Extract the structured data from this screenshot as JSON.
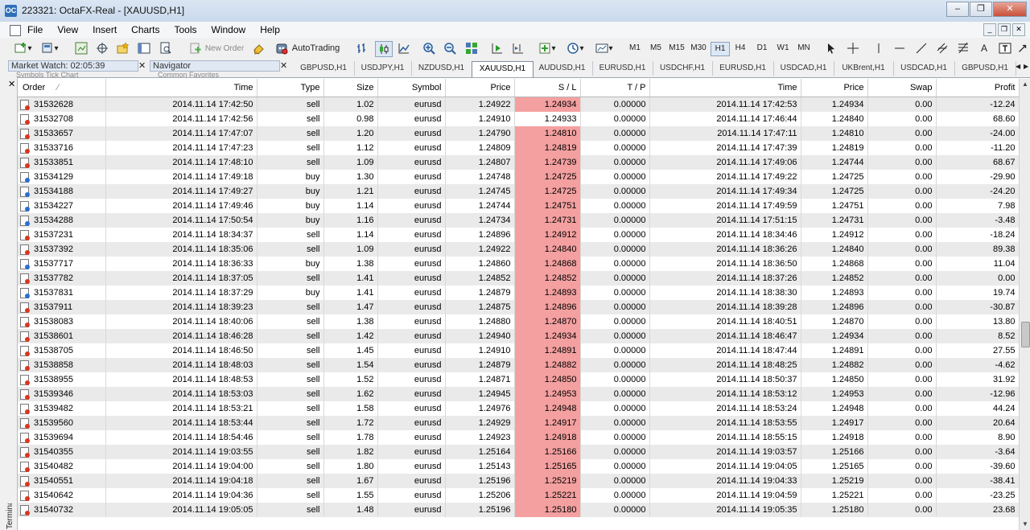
{
  "window": {
    "title": "223321: OctaFX-Real - [XAUUSD,H1]",
    "app_icon": "OC"
  },
  "menu": [
    "File",
    "View",
    "Insert",
    "Charts",
    "Tools",
    "Window",
    "Help"
  ],
  "toolbar": {
    "new_order": "New Order",
    "autotrading": "AutoTrading",
    "timeframes": [
      "M1",
      "M5",
      "M15",
      "M30",
      "H1",
      "H4",
      "D1",
      "W1",
      "MN"
    ],
    "active_timeframe": "H1"
  },
  "panels": {
    "market_watch": "Market Watch: 02:05:39",
    "market_watch_tabs": "Symbols    Tick Chart",
    "navigator": "Navigator",
    "navigator_tabs": "Common    Favorites"
  },
  "chart_tabs": [
    "GBPUSD,H1",
    "USDJPY,H1",
    "NZDUSD,H1",
    "XAUUSD,H1",
    "AUDUSD,H1",
    "EURUSD,H1",
    "USDCHF,H1",
    "EURUSD,H1",
    "USDCAD,H1",
    "UKBrent,H1",
    "USDCAD,H1",
    "GBPUSD,H1"
  ],
  "active_chart_tab": "XAUUSD,H1",
  "table": {
    "columns": [
      "Order",
      "Time",
      "Type",
      "Size",
      "Symbol",
      "Price",
      "S / L",
      "T / P",
      "Time",
      "Price",
      "Swap",
      "Profit"
    ],
    "rows": [
      [
        "31532628",
        "2014.11.14 17:42:50",
        "sell",
        "1.02",
        "eurusd",
        "1.24922",
        "1.24934",
        "0.00000",
        "2014.11.14 17:42:53",
        "1.24934",
        "0.00",
        "-12.24"
      ],
      [
        "31532708",
        "2014.11.14 17:42:56",
        "sell",
        "0.98",
        "eurusd",
        "1.24910",
        "1.24933",
        "0.00000",
        "2014.11.14 17:46:44",
        "1.24840",
        "0.00",
        "68.60"
      ],
      [
        "31533657",
        "2014.11.14 17:47:07",
        "sell",
        "1.20",
        "eurusd",
        "1.24790",
        "1.24810",
        "0.00000",
        "2014.11.14 17:47:11",
        "1.24810",
        "0.00",
        "-24.00"
      ],
      [
        "31533716",
        "2014.11.14 17:47:23",
        "sell",
        "1.12",
        "eurusd",
        "1.24809",
        "1.24819",
        "0.00000",
        "2014.11.14 17:47:39",
        "1.24819",
        "0.00",
        "-11.20"
      ],
      [
        "31533851",
        "2014.11.14 17:48:10",
        "sell",
        "1.09",
        "eurusd",
        "1.24807",
        "1.24739",
        "0.00000",
        "2014.11.14 17:49:06",
        "1.24744",
        "0.00",
        "68.67"
      ],
      [
        "31534129",
        "2014.11.14 17:49:18",
        "buy",
        "1.30",
        "eurusd",
        "1.24748",
        "1.24725",
        "0.00000",
        "2014.11.14 17:49:22",
        "1.24725",
        "0.00",
        "-29.90"
      ],
      [
        "31534188",
        "2014.11.14 17:49:27",
        "buy",
        "1.21",
        "eurusd",
        "1.24745",
        "1.24725",
        "0.00000",
        "2014.11.14 17:49:34",
        "1.24725",
        "0.00",
        "-24.20"
      ],
      [
        "31534227",
        "2014.11.14 17:49:46",
        "buy",
        "1.14",
        "eurusd",
        "1.24744",
        "1.24751",
        "0.00000",
        "2014.11.14 17:49:59",
        "1.24751",
        "0.00",
        "7.98"
      ],
      [
        "31534288",
        "2014.11.14 17:50:54",
        "buy",
        "1.16",
        "eurusd",
        "1.24734",
        "1.24731",
        "0.00000",
        "2014.11.14 17:51:15",
        "1.24731",
        "0.00",
        "-3.48"
      ],
      [
        "31537231",
        "2014.11.14 18:34:37",
        "sell",
        "1.14",
        "eurusd",
        "1.24896",
        "1.24912",
        "0.00000",
        "2014.11.14 18:34:46",
        "1.24912",
        "0.00",
        "-18.24"
      ],
      [
        "31537392",
        "2014.11.14 18:35:06",
        "sell",
        "1.09",
        "eurusd",
        "1.24922",
        "1.24840",
        "0.00000",
        "2014.11.14 18:36:26",
        "1.24840",
        "0.00",
        "89.38"
      ],
      [
        "31537717",
        "2014.11.14 18:36:33",
        "buy",
        "1.38",
        "eurusd",
        "1.24860",
        "1.24868",
        "0.00000",
        "2014.11.14 18:36:50",
        "1.24868",
        "0.00",
        "11.04"
      ],
      [
        "31537782",
        "2014.11.14 18:37:05",
        "sell",
        "1.41",
        "eurusd",
        "1.24852",
        "1.24852",
        "0.00000",
        "2014.11.14 18:37:26",
        "1.24852",
        "0.00",
        "0.00"
      ],
      [
        "31537831",
        "2014.11.14 18:37:29",
        "buy",
        "1.41",
        "eurusd",
        "1.24879",
        "1.24893",
        "0.00000",
        "2014.11.14 18:38:30",
        "1.24893",
        "0.00",
        "19.74"
      ],
      [
        "31537911",
        "2014.11.14 18:39:23",
        "sell",
        "1.47",
        "eurusd",
        "1.24875",
        "1.24896",
        "0.00000",
        "2014.11.14 18:39:28",
        "1.24896",
        "0.00",
        "-30.87"
      ],
      [
        "31538083",
        "2014.11.14 18:40:06",
        "sell",
        "1.38",
        "eurusd",
        "1.24880",
        "1.24870",
        "0.00000",
        "2014.11.14 18:40:51",
        "1.24870",
        "0.00",
        "13.80"
      ],
      [
        "31538601",
        "2014.11.14 18:46:28",
        "sell",
        "1.42",
        "eurusd",
        "1.24940",
        "1.24934",
        "0.00000",
        "2014.11.14 18:46:47",
        "1.24934",
        "0.00",
        "8.52"
      ],
      [
        "31538705",
        "2014.11.14 18:46:50",
        "sell",
        "1.45",
        "eurusd",
        "1.24910",
        "1.24891",
        "0.00000",
        "2014.11.14 18:47:44",
        "1.24891",
        "0.00",
        "27.55"
      ],
      [
        "31538858",
        "2014.11.14 18:48:03",
        "sell",
        "1.54",
        "eurusd",
        "1.24879",
        "1.24882",
        "0.00000",
        "2014.11.14 18:48:25",
        "1.24882",
        "0.00",
        "-4.62"
      ],
      [
        "31538955",
        "2014.11.14 18:48:53",
        "sell",
        "1.52",
        "eurusd",
        "1.24871",
        "1.24850",
        "0.00000",
        "2014.11.14 18:50:37",
        "1.24850",
        "0.00",
        "31.92"
      ],
      [
        "31539346",
        "2014.11.14 18:53:03",
        "sell",
        "1.62",
        "eurusd",
        "1.24945",
        "1.24953",
        "0.00000",
        "2014.11.14 18:53:12",
        "1.24953",
        "0.00",
        "-12.96"
      ],
      [
        "31539482",
        "2014.11.14 18:53:21",
        "sell",
        "1.58",
        "eurusd",
        "1.24976",
        "1.24948",
        "0.00000",
        "2014.11.14 18:53:24",
        "1.24948",
        "0.00",
        "44.24"
      ],
      [
        "31539560",
        "2014.11.14 18:53:44",
        "sell",
        "1.72",
        "eurusd",
        "1.24929",
        "1.24917",
        "0.00000",
        "2014.11.14 18:53:55",
        "1.24917",
        "0.00",
        "20.64"
      ],
      [
        "31539694",
        "2014.11.14 18:54:46",
        "sell",
        "1.78",
        "eurusd",
        "1.24923",
        "1.24918",
        "0.00000",
        "2014.11.14 18:55:15",
        "1.24918",
        "0.00",
        "8.90"
      ],
      [
        "31540355",
        "2014.11.14 19:03:55",
        "sell",
        "1.82",
        "eurusd",
        "1.25164",
        "1.25166",
        "0.00000",
        "2014.11.14 19:03:57",
        "1.25166",
        "0.00",
        "-3.64"
      ],
      [
        "31540482",
        "2014.11.14 19:04:00",
        "sell",
        "1.80",
        "eurusd",
        "1.25143",
        "1.25165",
        "0.00000",
        "2014.11.14 19:04:05",
        "1.25165",
        "0.00",
        "-39.60"
      ],
      [
        "31540551",
        "2014.11.14 19:04:18",
        "sell",
        "1.67",
        "eurusd",
        "1.25196",
        "1.25219",
        "0.00000",
        "2014.11.14 19:04:33",
        "1.25219",
        "0.00",
        "-38.41"
      ],
      [
        "31540642",
        "2014.11.14 19:04:36",
        "sell",
        "1.55",
        "eurusd",
        "1.25206",
        "1.25221",
        "0.00000",
        "2014.11.14 19:04:59",
        "1.25221",
        "0.00",
        "-23.25"
      ],
      [
        "31540732",
        "2014.11.14 19:05:05",
        "sell",
        "1.48",
        "eurusd",
        "1.25196",
        "1.25180",
        "0.00000",
        "2014.11.14 19:05:35",
        "1.25180",
        "0.00",
        "23.68"
      ]
    ],
    "sl_white_rows": [
      1
    ]
  },
  "side_label": "Terminal",
  "colors": {
    "sl_highlight": "#f4a0a0",
    "row_alt": "#eaeaea",
    "sell_dot": "#d9371f",
    "buy_dot": "#2a6fd1"
  }
}
